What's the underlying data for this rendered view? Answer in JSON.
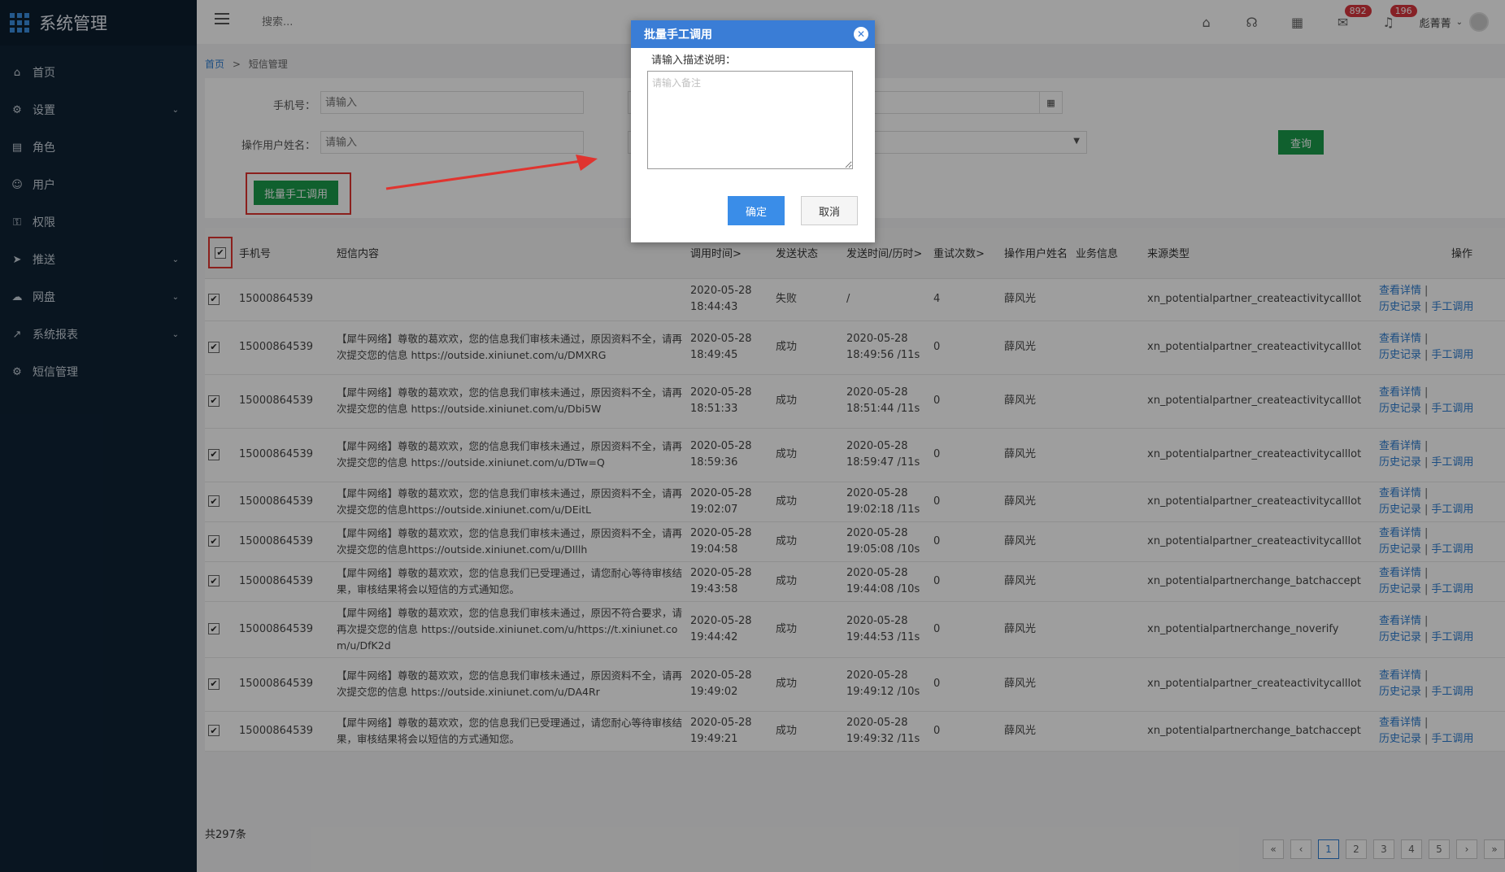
{
  "sidebar": {
    "title": "系统管理",
    "items": [
      {
        "label": "首页",
        "icon": "home-icon",
        "chev": ""
      },
      {
        "label": "设置",
        "icon": "gear-icon",
        "chev": "⌄"
      },
      {
        "label": "角色",
        "icon": "role-icon",
        "chev": ""
      },
      {
        "label": "用户",
        "icon": "user-icon",
        "chev": ""
      },
      {
        "label": "权限",
        "icon": "lock-icon",
        "chev": ""
      },
      {
        "label": "推送",
        "icon": "send-icon",
        "chev": "⌄"
      },
      {
        "label": "网盘",
        "icon": "cloud-icon",
        "chev": "⌄"
      },
      {
        "label": "系统报表",
        "icon": "chart-icon",
        "chev": "⌄"
      },
      {
        "label": "短信管理",
        "icon": "gear-icon",
        "chev": ""
      }
    ]
  },
  "topbar": {
    "search_placeholder": "搜索...",
    "badge_mail": "892",
    "badge_bell": "196",
    "user_name": "彪菁菁"
  },
  "breadcrumb": {
    "home": "首页",
    "sep": ">",
    "current": "短信管理"
  },
  "filter": {
    "phone_label": "手机号：",
    "phone_placeholder": "请输入",
    "operator_label": "操作用户姓名：",
    "operator_placeholder": "请输入",
    "query_button": "查询",
    "batch_button": "批量手工调用"
  },
  "table": {
    "headers": [
      "手机号",
      "短信内容",
      "调用时间>",
      "发送状态",
      "发送时间/历时>",
      "重试次数>",
      "操作用户姓名",
      "业务信息",
      "来源类型",
      "操作"
    ],
    "op_detail": "查看详情",
    "op_history": "历史记录",
    "op_manual": "手工调用",
    "rows": [
      {
        "phone": "15000864539",
        "content": "",
        "call_time": "2020-05-28 18:44:43",
        "status": "失败",
        "send_time": "/",
        "retries": "4",
        "operator": "薛风光",
        "biz": "",
        "source": "xn_potentialpartner_createactivitycalllot"
      },
      {
        "phone": "15000864539",
        "content": "【犀牛网络】尊敬的葛欢欢，您的信息我们审核未通过，原因资料不全，请再次提交您的信息 https://outside.xiniunet.com/u/DMXRG",
        "call_time": "2020-05-28 18:49:45",
        "status": "成功",
        "send_time": "2020-05-28 18:49:56 /11s",
        "retries": "0",
        "operator": "薛风光",
        "biz": "",
        "source": "xn_potentialpartner_createactivitycalllot"
      },
      {
        "phone": "15000864539",
        "content": "【犀牛网络】尊敬的葛欢欢，您的信息我们审核未通过，原因资料不全，请再次提交您的信息 https://outside.xiniunet.com/u/Dbi5W",
        "call_time": "2020-05-28 18:51:33",
        "status": "成功",
        "send_time": "2020-05-28 18:51:44 /11s",
        "retries": "0",
        "operator": "薛风光",
        "biz": "",
        "source": "xn_potentialpartner_createactivitycalllot"
      },
      {
        "phone": "15000864539",
        "content": "【犀牛网络】尊敬的葛欢欢，您的信息我们审核未通过，原因资料不全，请再次提交您的信息 https://outside.xiniunet.com/u/DTw=Q",
        "call_time": "2020-05-28 18:59:36",
        "status": "成功",
        "send_time": "2020-05-28 18:59:47 /11s",
        "retries": "0",
        "operator": "薛风光",
        "biz": "",
        "source": "xn_potentialpartner_createactivitycalllot"
      },
      {
        "phone": "15000864539",
        "content": "【犀牛网络】尊敬的葛欢欢，您的信息我们审核未通过，原因资料不全，请再次提交您的信息https://outside.xiniunet.com/u/DEitL",
        "call_time": "2020-05-28 19:02:07",
        "status": "成功",
        "send_time": "2020-05-28 19:02:18 /11s",
        "retries": "0",
        "operator": "薛风光",
        "biz": "",
        "source": "xn_potentialpartner_createactivitycalllot"
      },
      {
        "phone": "15000864539",
        "content": "【犀牛网络】尊敬的葛欢欢，您的信息我们审核未通过，原因资料不全，请再次提交您的信息https://outside.xiniunet.com/u/DIllh",
        "call_time": "2020-05-28 19:04:58",
        "status": "成功",
        "send_time": "2020-05-28 19:05:08 /10s",
        "retries": "0",
        "operator": "薛风光",
        "biz": "",
        "source": "xn_potentialpartner_createactivitycalllot"
      },
      {
        "phone": "15000864539",
        "content": "【犀牛网络】尊敬的葛欢欢，您的信息我们已受理通过，请您耐心等待审核结果，审核结果将会以短信的方式通知您。",
        "call_time": "2020-05-28 19:43:58",
        "status": "成功",
        "send_time": "2020-05-28 19:44:08 /10s",
        "retries": "0",
        "operator": "薛风光",
        "biz": "",
        "source": "xn_potentialpartnerchange_batchaccept"
      },
      {
        "phone": "15000864539",
        "content": "【犀牛网络】尊敬的葛欢欢，您的信息我们审核未通过，原因不符合要求，请再次提交您的信息 https://outside.xiniunet.com/u/https://t.xiniunet.com/u/DfK2d",
        "call_time": "2020-05-28 19:44:42",
        "status": "成功",
        "send_time": "2020-05-28 19:44:53 /11s",
        "retries": "0",
        "operator": "薛风光",
        "biz": "",
        "source": "xn_potentialpartnerchange_noverify"
      },
      {
        "phone": "15000864539",
        "content": "【犀牛网络】尊敬的葛欢欢，您的信息我们审核未通过，原因资料不全，请再次提交您的信息 https://outside.xiniunet.com/u/DA4Rr",
        "call_time": "2020-05-28 19:49:02",
        "status": "成功",
        "send_time": "2020-05-28 19:49:12 /10s",
        "retries": "0",
        "operator": "薛风光",
        "biz": "",
        "source": "xn_potentialpartner_createactivitycalllot"
      },
      {
        "phone": "15000864539",
        "content": "【犀牛网络】尊敬的葛欢欢，您的信息我们已受理通过，请您耐心等待审核结果，审核结果将会以短信的方式通知您。",
        "call_time": "2020-05-28 19:49:21",
        "status": "成功",
        "send_time": "2020-05-28 19:49:32 /11s",
        "retries": "0",
        "operator": "薛风光",
        "biz": "",
        "source": "xn_potentialpartnerchange_batchaccept"
      }
    ]
  },
  "footer": {
    "total": "共297条",
    "pages": [
      "«",
      "‹",
      "1",
      "2",
      "3",
      "4",
      "5",
      "›",
      "»"
    ]
  },
  "dialog": {
    "title": "批量手工调用",
    "label": "请输入描述说明：",
    "placeholder": "请输入备注",
    "ok": "确定",
    "cancel": "取消"
  },
  "colors": {
    "sidebar_bg": "#0f2235",
    "primary_green": "#1a9b4b",
    "dialog_header": "#3a7dd6",
    "highlight_red": "#e0342f",
    "link_blue": "#2d7dd2"
  }
}
